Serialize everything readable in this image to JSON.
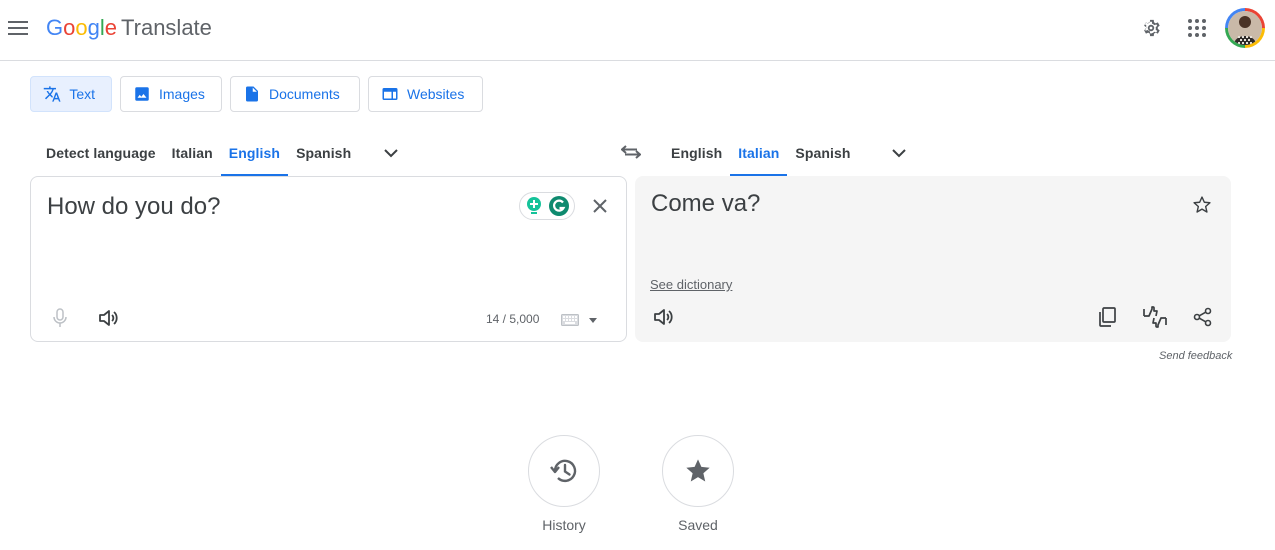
{
  "header": {
    "logo_google": "Google",
    "logo_product": "Translate",
    "icons": [
      "menu-icon",
      "settings-icon",
      "apps-icon",
      "avatar"
    ]
  },
  "modes": [
    {
      "label": "Text",
      "icon": "translate-icon",
      "active": true
    },
    {
      "label": "Images",
      "icon": "image-icon",
      "active": false
    },
    {
      "label": "Documents",
      "icon": "document-icon",
      "active": false
    },
    {
      "label": "Websites",
      "icon": "website-icon",
      "active": false
    }
  ],
  "source_langs": {
    "detect": "Detect language",
    "items": [
      "Italian",
      "English",
      "Spanish"
    ],
    "active": "English"
  },
  "target_langs": {
    "items": [
      "English",
      "Italian",
      "Spanish"
    ],
    "active": "Italian"
  },
  "source": {
    "text": "How do you do?",
    "char_count": "14 / 5,000"
  },
  "target": {
    "text": "Come va?",
    "see_dictionary": "See dictionary"
  },
  "feedback": "Send feedback",
  "bottom": {
    "history": "History",
    "saved": "Saved"
  },
  "colors": {
    "accent": "#1a73e8",
    "active_bg": "#e8f0fe",
    "border": "#dadce0",
    "target_bg": "#f5f5f5"
  }
}
